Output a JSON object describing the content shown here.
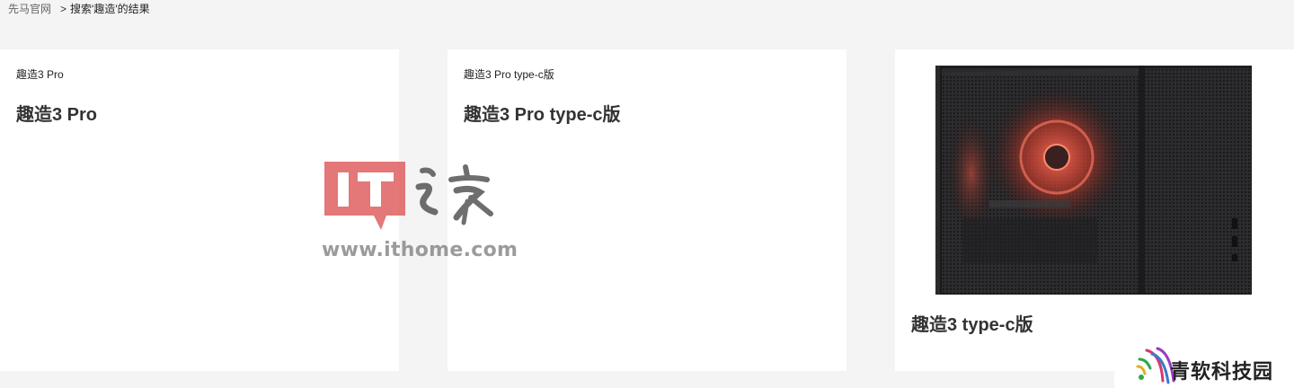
{
  "breadcrumb": {
    "home": "先马官网",
    "separator": ">",
    "current": "搜索'趣造'的结果"
  },
  "results": [
    {
      "small_title": "趣造3 Pro",
      "title": "趣造3 Pro",
      "has_image": false
    },
    {
      "small_title": "趣造3 Pro type-c版",
      "title": "趣造3 Pro type-c版",
      "has_image": false
    },
    {
      "small_title": "",
      "title": "趣造3 type-c版",
      "has_image": true,
      "image_desc": "pc-case-mesh-red-fans"
    }
  ],
  "watermarks": {
    "ithome_logo_text": "IT之家",
    "ithome_url": "www.ithome.com",
    "qingruan_text": "青软科技园"
  },
  "colors": {
    "page_bg": "#f4f4f4",
    "card_bg": "#ffffff",
    "ithome_red": "#e05a5a",
    "case_dark": "#2a2a2c",
    "fan_glow": "#d04030"
  }
}
